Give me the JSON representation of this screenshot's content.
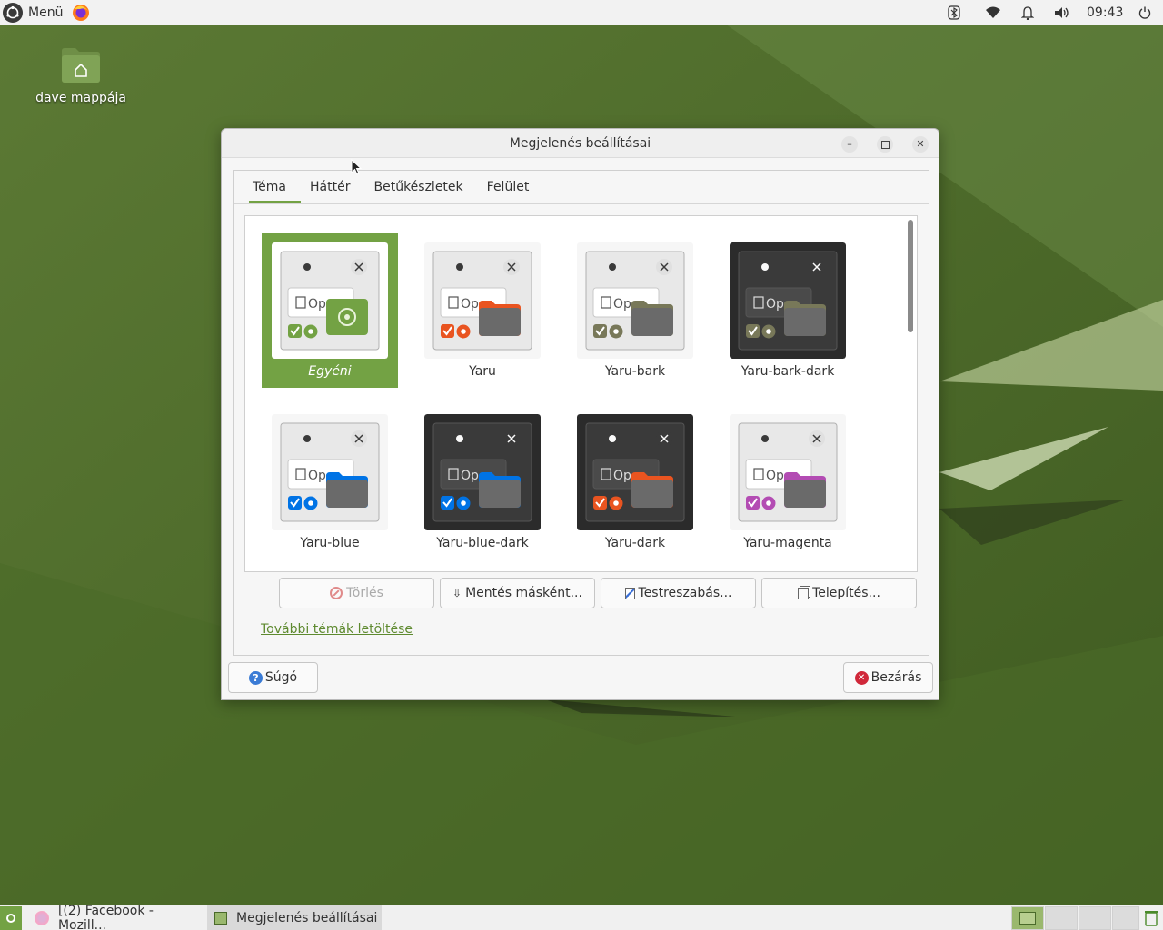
{
  "top_panel": {
    "menu_label": "Menü",
    "clock": "09:43",
    "icons": [
      "ubuntu-menu-icon",
      "firefox-icon",
      "bluetooth-icon",
      "wifi-icon",
      "bell-icon",
      "volume-icon",
      "power-icon"
    ]
  },
  "desktop": {
    "home_label": "dave mappája"
  },
  "window": {
    "title": "Megjelenés beállításai",
    "tabs": [
      {
        "label": "Téma",
        "active": true
      },
      {
        "label": "Háttér",
        "active": false
      },
      {
        "label": "Betűkészletek",
        "active": false
      },
      {
        "label": "Felület",
        "active": false
      }
    ],
    "themes": [
      {
        "name": "Egyéni",
        "dark": false,
        "accent": "#73a244",
        "selected": true
      },
      {
        "name": "Yaru",
        "dark": false,
        "accent": "#e95420",
        "selected": false
      },
      {
        "name": "Yaru-bark",
        "dark": false,
        "accent": "#787859",
        "selected": false
      },
      {
        "name": "Yaru-bark-dark",
        "dark": true,
        "accent": "#787859",
        "selected": false
      },
      {
        "name": "Yaru-blue",
        "dark": false,
        "accent": "#0073e5",
        "selected": false
      },
      {
        "name": "Yaru-blue-dark",
        "dark": true,
        "accent": "#0073e5",
        "selected": false
      },
      {
        "name": "Yaru-dark",
        "dark": true,
        "accent": "#e95420",
        "selected": false
      },
      {
        "name": "Yaru-magenta",
        "dark": false,
        "accent": "#b34cb3",
        "selected": false
      }
    ],
    "thumb_text": "Op",
    "buttons": {
      "delete": "Törlés",
      "save_as": "Mentés másként...",
      "customize": "Testreszabás...",
      "install": "Telepítés..."
    },
    "more_themes_link": "További témák letöltése",
    "help": "Súgó",
    "close": "Bezárás"
  },
  "taskbar": {
    "tasks": [
      {
        "label": "[(2) Facebook - Mozill...",
        "icon": "firefox-icon"
      },
      {
        "label": "Megjelenés beállításai",
        "icon": "appearance-icon"
      }
    ]
  },
  "colors": {
    "accent": "#73a244",
    "desktop": "#4f6a2c"
  }
}
